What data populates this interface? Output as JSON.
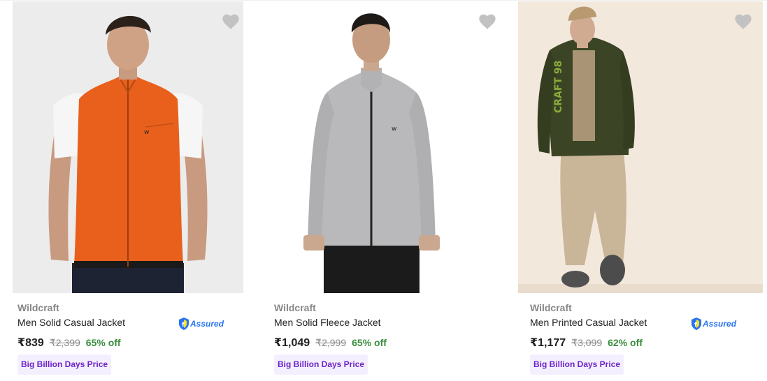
{
  "products": [
    {
      "brand": "Wildcraft",
      "title": "Men Solid Casual Jacket",
      "price": "₹839",
      "mrp": "₹2,399",
      "discount": "65% off",
      "assured": true,
      "assured_label": "Assured",
      "badge": "Big Billion Days Price",
      "jacket_color": "#e8601c",
      "icons": [
        "heart-icon",
        "assured-shield-icon"
      ]
    },
    {
      "brand": "Wildcraft",
      "title": "Men Solid Fleece Jacket",
      "price": "₹1,049",
      "mrp": "₹2,999",
      "discount": "65% off",
      "assured": false,
      "badge": "Big Billion Days Price",
      "jacket_color": "#b9b9bb",
      "icons": [
        "heart-icon"
      ]
    },
    {
      "brand": "Wildcraft",
      "title": "Men Printed Casual Jacket",
      "price": "₹1,177",
      "mrp": "₹3,099",
      "discount": "62% off",
      "assured": true,
      "assured_label": "Assured",
      "badge": "Big Billion Days Price",
      "jacket_color": "#3b4425",
      "icons": [
        "heart-icon",
        "assured-shield-icon"
      ]
    }
  ],
  "colors": {
    "brand_gray": "#878787",
    "title": "#212121",
    "discount_green": "#388e3c",
    "assured_blue": "#2874f0",
    "badge_bg": "#f4efff",
    "badge_text": "#6d24c5",
    "heart": "#c2c2c2"
  }
}
